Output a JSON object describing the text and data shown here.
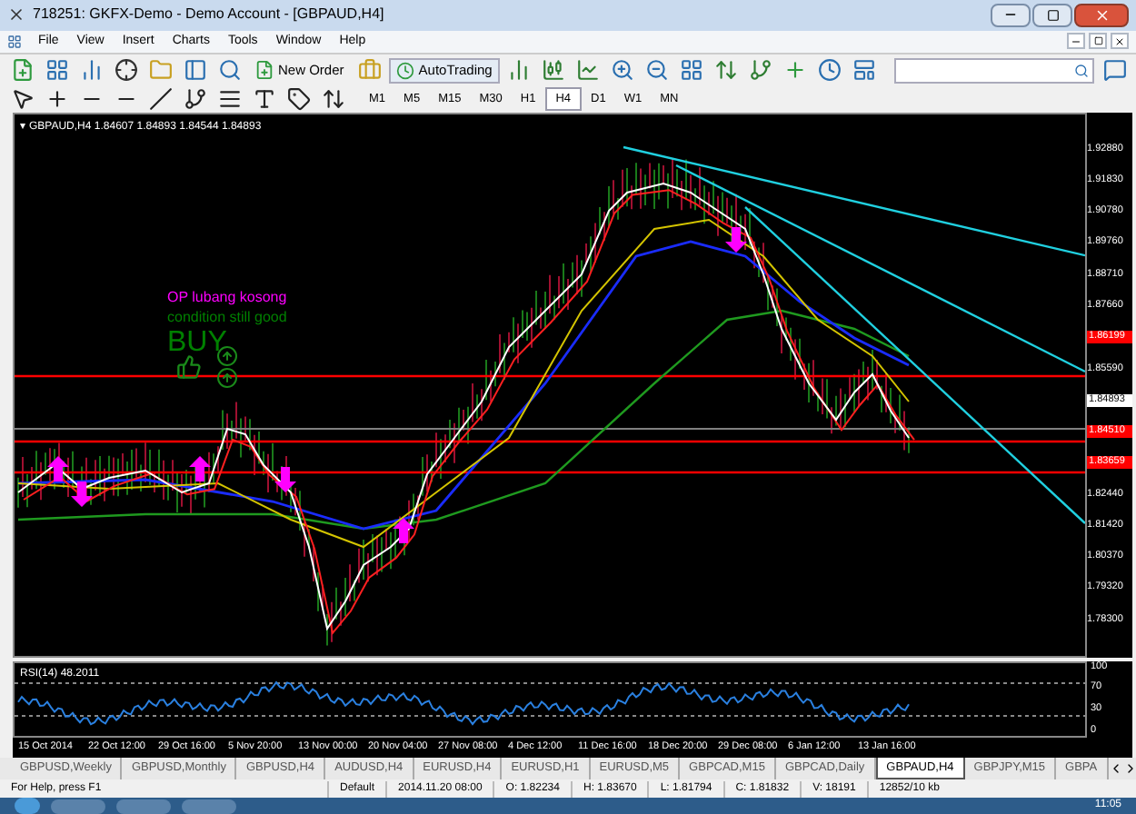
{
  "window": {
    "title": "718251: GKFX-Demo - Demo Account - [GBPAUD,H4]"
  },
  "menu": [
    "File",
    "View",
    "Insert",
    "Charts",
    "Tools",
    "Window",
    "Help"
  ],
  "toolbar": {
    "new_order": "New Order",
    "autotrading": "AutoTrading"
  },
  "timeframes": [
    {
      "label": "M1",
      "selected": false
    },
    {
      "label": "M5",
      "selected": false
    },
    {
      "label": "M15",
      "selected": false
    },
    {
      "label": "M30",
      "selected": false
    },
    {
      "label": "H1",
      "selected": false
    },
    {
      "label": "H4",
      "selected": true
    },
    {
      "label": "D1",
      "selected": false
    },
    {
      "label": "W1",
      "selected": false
    },
    {
      "label": "MN",
      "selected": false
    }
  ],
  "chart": {
    "header_marker": "▾",
    "header": "GBPAUD,H4  1.84607 1.84893 1.84544 1.84893",
    "annotations": [
      {
        "text": "OP lubang kosong",
        "kind": "note",
        "color": "#ff00ff"
      },
      {
        "text": "condition still good",
        "kind": "note",
        "color": "#008000"
      },
      {
        "text": "BUY",
        "kind": "signal",
        "color": "#008000"
      }
    ],
    "price_labels": [
      {
        "text": "1.92880",
        "kind": "tick"
      },
      {
        "text": "1.91830",
        "kind": "tick"
      },
      {
        "text": "1.90780",
        "kind": "tick"
      },
      {
        "text": "1.89760",
        "kind": "tick"
      },
      {
        "text": "1.88710",
        "kind": "tick"
      },
      {
        "text": "1.87660",
        "kind": "tick"
      },
      {
        "text": "1.86199",
        "kind": "line"
      },
      {
        "text": "1.85590",
        "kind": "tick"
      },
      {
        "text": "1.84893",
        "kind": "bid"
      },
      {
        "text": "1.84510",
        "kind": "line"
      },
      {
        "text": "1.83659",
        "kind": "line"
      },
      {
        "text": "1.82440",
        "kind": "tick"
      },
      {
        "text": "1.81420",
        "kind": "tick"
      },
      {
        "text": "1.80370",
        "kind": "tick"
      },
      {
        "text": "1.79320",
        "kind": "tick"
      },
      {
        "text": "1.78300",
        "kind": "tick"
      }
    ],
    "rsi": {
      "title": "RSI(14) 48.2011",
      "scale": [
        "100",
        "70",
        "30",
        "0"
      ]
    },
    "time_labels": [
      "15 Oct 2014",
      "22 Oct 12:00",
      "29 Oct 16:00",
      "5 Nov 20:00",
      "13 Nov 00:00",
      "20 Nov 04:00",
      "27 Nov 08:00",
      "4 Dec 12:00",
      "11 Dec 16:00",
      "18 Dec 20:00",
      "29 Dec 08:00",
      "6 Jan 12:00",
      "13 Jan 16:00"
    ]
  },
  "tabs": [
    {
      "label": "GBPUSD,Weekly",
      "selected": false
    },
    {
      "label": "GBPUSD,Monthly",
      "selected": false
    },
    {
      "label": "GBPUSD,H4",
      "selected": false
    },
    {
      "label": "AUDUSD,H4",
      "selected": false
    },
    {
      "label": "EURUSD,H4",
      "selected": false
    },
    {
      "label": "EURUSD,H1",
      "selected": false
    },
    {
      "label": "EURUSD,M5",
      "selected": false
    },
    {
      "label": "GBPCAD,M15",
      "selected": false
    },
    {
      "label": "GBPCAD,Daily",
      "selected": false
    },
    {
      "label": "GBPAUD,H4",
      "selected": true
    },
    {
      "label": "GBPJPY,M15",
      "selected": false
    },
    {
      "label": "GBPA",
      "selected": false
    }
  ],
  "status_bar": [
    "For Help, press F1",
    "Default",
    "2014.11.20 08:00",
    "O: 1.82234",
    "H: 1.83670",
    "L: 1.81794",
    "C: 1.81832",
    "V: 18191",
    "12852/10 kb"
  ],
  "taskbar": {
    "clock": "11:05"
  }
}
